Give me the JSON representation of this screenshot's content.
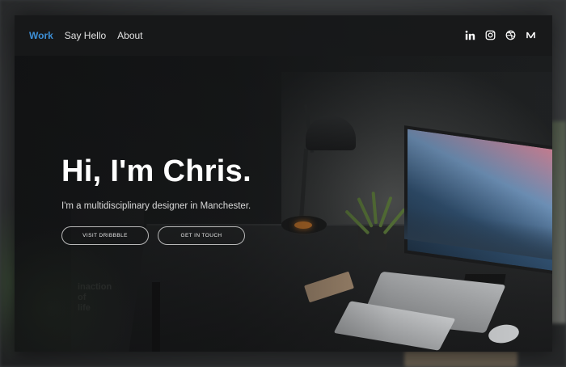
{
  "nav": {
    "links": [
      {
        "label": "Work",
        "active": true
      },
      {
        "label": "Say Hello",
        "active": false
      },
      {
        "label": "About",
        "active": false
      }
    ],
    "social_icons": [
      "linkedin-icon",
      "instagram-icon",
      "dribbble-icon",
      "medium-icon"
    ]
  },
  "hero": {
    "title": "Hi, I'm Chris.",
    "subtitle": "I'm a multidisciplinary designer in Manchester.",
    "buttons": {
      "dribbble": "VISIT DRIBBBLE",
      "contact": "GET IN TOUCH"
    }
  },
  "poster_text": "inaction\nof\nlife",
  "colors": {
    "accent": "#3d8fd6",
    "text": "#ffffff",
    "nav_bg": "#18191a"
  }
}
